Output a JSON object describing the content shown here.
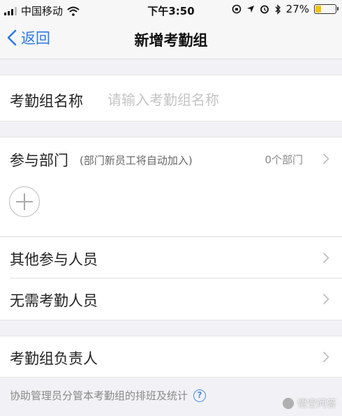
{
  "status_bar": {
    "carrier": "中国移动",
    "time": "下午3:50",
    "battery_percent": "27%",
    "battery_level": 0.27,
    "battery_color": "#f2c200",
    "icons": [
      "signal-icon",
      "wifi-icon",
      "orientation-lock-icon",
      "location-icon",
      "alarm-icon",
      "bluetooth-icon",
      "battery-icon"
    ]
  },
  "nav": {
    "back_label": "返回",
    "title": "新增考勤组",
    "accent_color": "#2f7ae5"
  },
  "form": {
    "group_name": {
      "label": "考勤组名称",
      "value": "",
      "placeholder": "请输入考勤组名称"
    },
    "departments": {
      "label": "参与部门",
      "hint": "(部门新员工将自动加入)",
      "count_text": "0个部门",
      "add_icon": "plus-circle-icon"
    },
    "other_participants": {
      "label": "其他参与人员"
    },
    "exempt_members": {
      "label": "无需考勤人员"
    },
    "group_owner": {
      "label": "考勤组负责人",
      "note": "协助管理员分管本考勤组的排班及统计",
      "help_icon_text": "?"
    }
  },
  "watermark": {
    "text": "悟空问答"
  }
}
